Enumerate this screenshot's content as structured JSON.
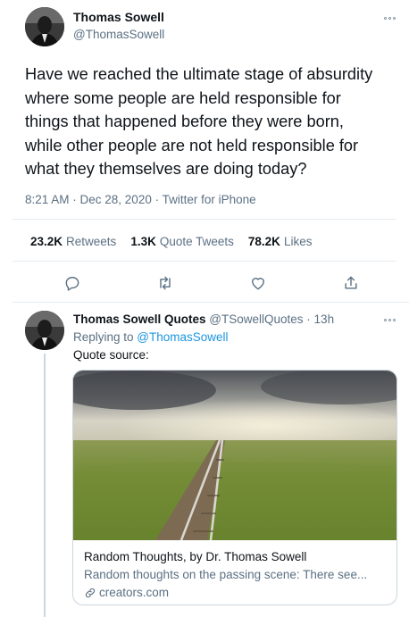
{
  "tweet": {
    "author_name": "Thomas Sowell",
    "author_handle": "@ThomasSowell",
    "text": "Have we reached the ultimate stage of absurdity where some people are held responsible for things that happened before they were born, while other people are not held responsible for what they themselves are doing today?",
    "lines": [
      "Have we reached the ultimate stage of absurdity",
      "where some people are held responsible for",
      "things that happened before they were born,",
      "while other people are not held responsible for",
      "what they themselves are doing today?"
    ],
    "timestamp": "8:21 AM · Dec 28, 2020 · Twitter for iPhone",
    "stats": {
      "retweets_count": "23.2K",
      "retweets_label": "Retweets",
      "quotes_count": "1.3K",
      "quotes_label": "Quote Tweets",
      "likes_count": "78.2K",
      "likes_label": "Likes"
    },
    "actions": [
      "reply-icon",
      "retweet-icon",
      "like-icon",
      "share-icon"
    ]
  },
  "reply": {
    "author_name": "Thomas Sowell Quotes",
    "author_handle": "@TSowellQuotes",
    "time_sep": " · ",
    "time": "13h",
    "replying_prefix": "Replying to ",
    "replying_handle": "@ThomasSowell",
    "text": "Quote source:",
    "card": {
      "title": "Random Thoughts, by Dr. Thomas Sowell",
      "description": "Random thoughts on the passing scene: There see...",
      "domain": "creators.com",
      "link_icon": "link-icon"
    }
  },
  "colors": {
    "accent": "#1b95e0",
    "muted": "#5b7083",
    "border": "#e6ecf0"
  }
}
